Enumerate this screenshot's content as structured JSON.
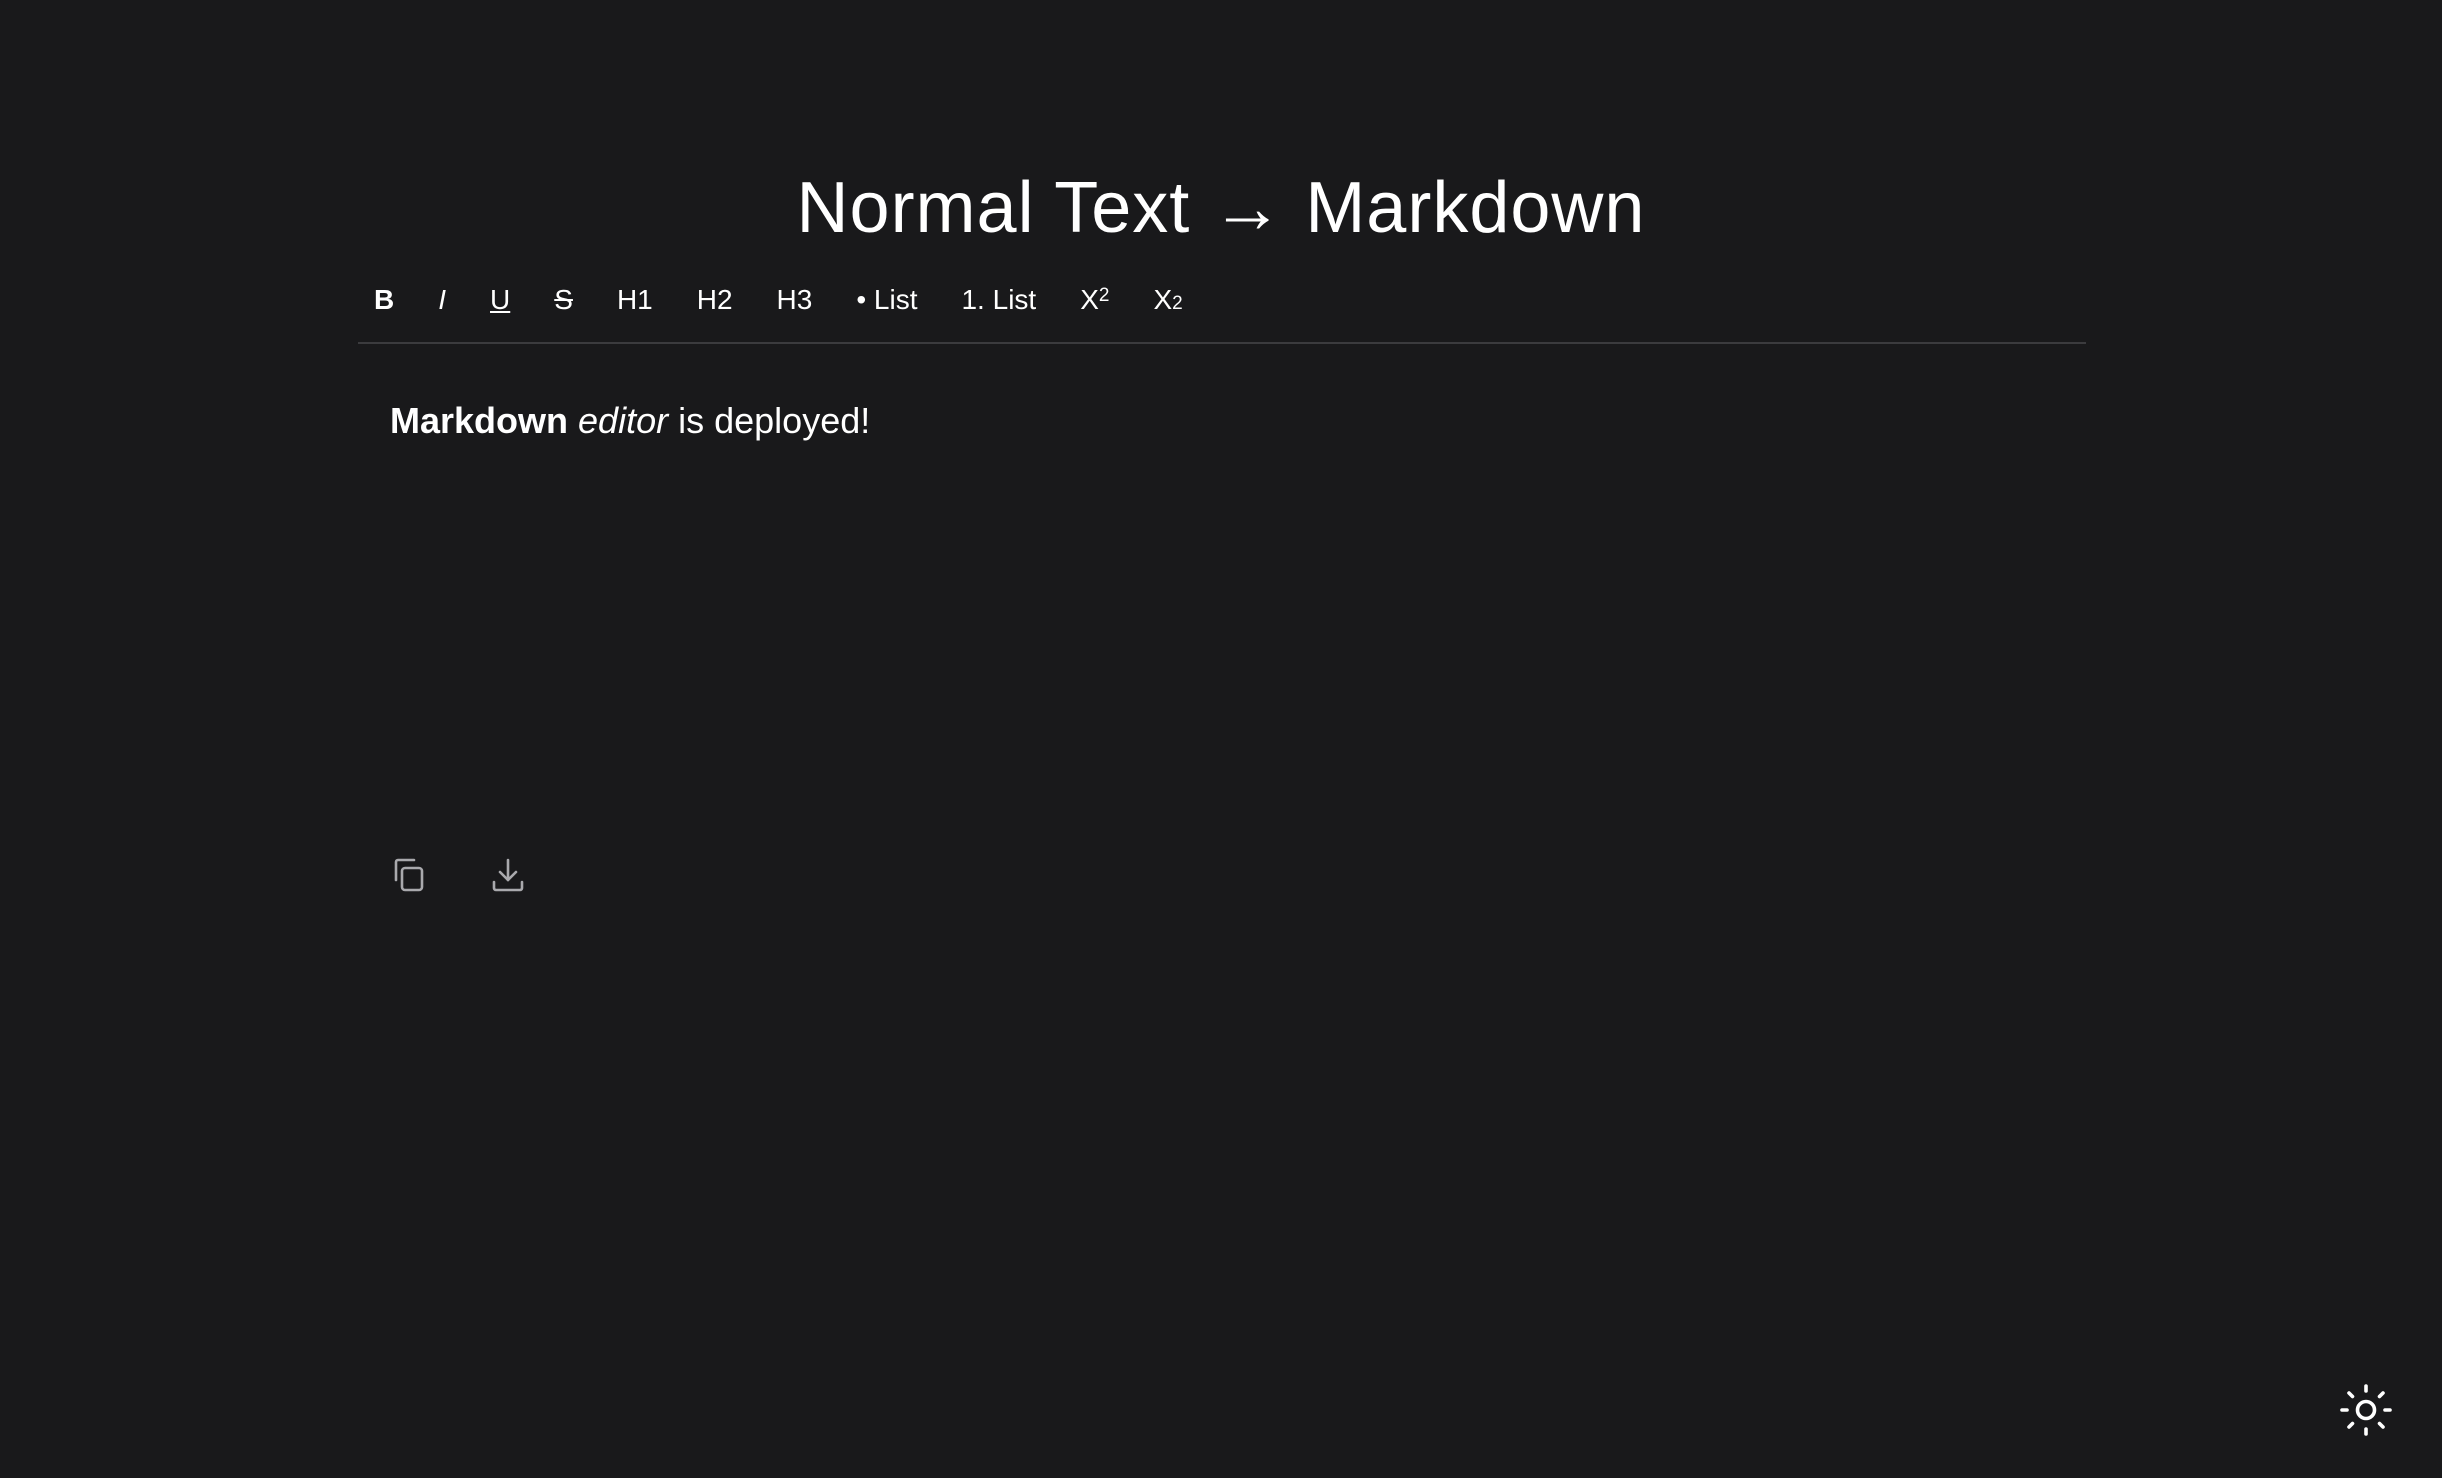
{
  "header": {
    "title": "Normal Text → Markdown"
  },
  "toolbar": {
    "bold": "B",
    "italic": "I",
    "underline": "U",
    "strike": "S",
    "h1": "H1",
    "h2": "H2",
    "h3": "H3",
    "bullet_list": "• List",
    "numbered_list": "1. List",
    "superscript_base": "X",
    "superscript_exp": "2",
    "subscript_base": "X",
    "subscript_exp": "2"
  },
  "editor": {
    "bold_text": "Markdown",
    "italic_text": "editor",
    "plain_text": "is deployed!"
  },
  "icons": {
    "copy": "copy-icon",
    "download": "download-icon",
    "theme": "sun-icon"
  },
  "colors": {
    "background": "#19191b",
    "text": "#ffffff",
    "icon_muted": "#a9a9ad",
    "divider": "#3b3b3e"
  }
}
